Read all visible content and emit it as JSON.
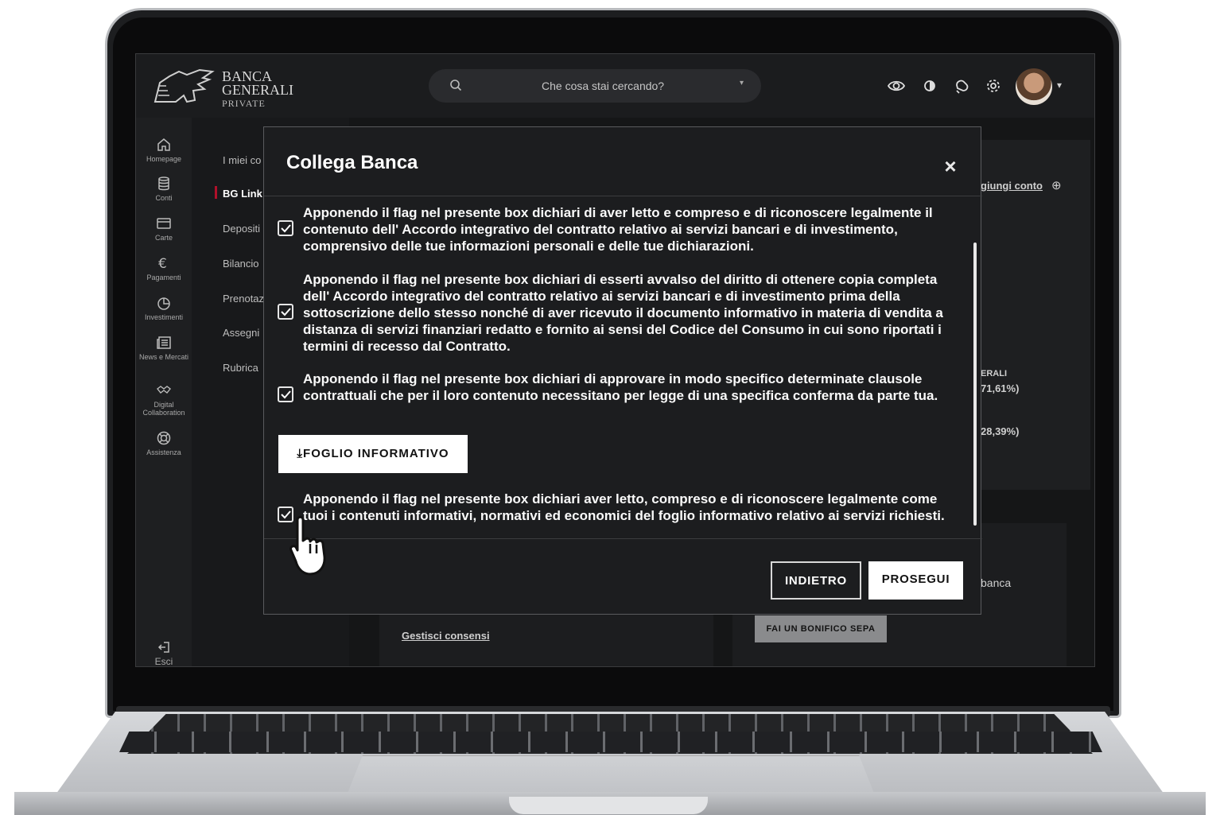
{
  "header": {
    "logo_line1": "BANCA",
    "logo_line2": "GENERALI",
    "logo_line3": "PRIVATE",
    "search_placeholder": "Che cosa stai cercando?"
  },
  "rail": {
    "items": [
      {
        "label": "Homepage",
        "icon": "home-icon"
      },
      {
        "label": "Conti",
        "icon": "database-icon"
      },
      {
        "label": "Carte",
        "icon": "card-icon"
      },
      {
        "label": "Pagamenti",
        "icon": "euro-icon"
      },
      {
        "label": "Investimenti",
        "icon": "pie-chart-icon"
      },
      {
        "label": "News e Mercati",
        "icon": "news-icon"
      },
      {
        "label": "Digital Collaboration",
        "icon": "handshake-icon"
      },
      {
        "label": "Assistenza",
        "icon": "lifebuoy-icon"
      }
    ],
    "logout_label": "Esci"
  },
  "submenu": {
    "items": [
      "I miei co",
      "BG Link",
      "Depositi",
      "Bilancio",
      "Prenotaz",
      "Assegni",
      "Rubrica"
    ],
    "active_index": 1
  },
  "background": {
    "add_account": "giungi conto",
    "legend1_label": "ERALI",
    "legend1_value": "71,61%)",
    "legend2_value": "28,39%)",
    "bank_text": "banca",
    "manage_consents": "Gestisci consensi",
    "sepa_button": "FAI UN BONIFICO SEPA"
  },
  "modal": {
    "title": "Collega Banca",
    "consents": [
      {
        "checked": true,
        "text": "Apponendo il flag nel presente box dichiari di aver letto e compreso e di riconoscere legalmente il contenuto dell' Accordo integrativo del contratto relativo ai servizi bancari e di investimento, comprensivo delle tue informazioni personali e delle tue dichiarazioni."
      },
      {
        "checked": true,
        "text": "Apponendo il flag nel presente box dichiari di esserti avvalso del diritto di ottenere copia completa dell' Accordo integrativo del contratto relativo ai servizi bancari e di investimento prima della sottoscrizione dello stesso nonché di aver ricevuto il documento informativo in materia di vendita a distanza di servizi finanziari redatto e fornito ai sensi del Codice del Consumo in cui sono riportati i termini di recesso dal Contratto."
      },
      {
        "checked": true,
        "text": "Apponendo il flag nel presente box dichiari di approvare in modo specifico determinate clausole contrattuali che per il loro contenuto necessitano per legge di una specifica conferma da parte tua."
      },
      {
        "checked": true,
        "text": "Apponendo il flag nel presente box dichiari aver letto, compreso e di riconoscere legalmente come tuoi i contenuti informativi, normativi ed economici del foglio informativo relativo ai servizi richiesti."
      }
    ],
    "download_label": "FOGLIO INFORMATIVO",
    "back_label": "INDIETRO",
    "next_label": "PROSEGUI"
  },
  "colors": {
    "accent": "#b0102a",
    "modal_bg": "#1c1d1f",
    "screen_bg": "#141516"
  }
}
